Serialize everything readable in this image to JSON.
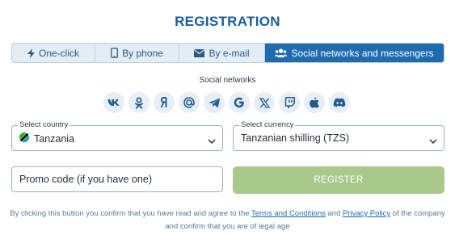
{
  "title": "REGISTRATION",
  "tabs": [
    {
      "label": "One-click",
      "icon": "lightning-icon",
      "active": false
    },
    {
      "label": "By phone",
      "icon": "phone-icon",
      "active": false
    },
    {
      "label": "By e-mail",
      "icon": "envelope-icon",
      "active": false
    },
    {
      "label": "Social networks and messengers",
      "icon": "users-icon",
      "active": true
    }
  ],
  "social": {
    "label": "Social networks",
    "networks": [
      {
        "name": "VK",
        "icon": "vk-icon",
        "glyph": "vk"
      },
      {
        "name": "Odnoklassniki",
        "icon": "odnoklassniki-icon",
        "glyph": "ok"
      },
      {
        "name": "Yandex",
        "icon": "yandex-icon",
        "glyph": "я"
      },
      {
        "name": "Mail.ru",
        "icon": "mail-ru-icon",
        "glyph": "@"
      },
      {
        "name": "Telegram",
        "icon": "telegram-icon",
        "glyph": "tg"
      },
      {
        "name": "Google",
        "icon": "google-icon",
        "glyph": "G"
      },
      {
        "name": "X",
        "icon": "x-icon",
        "glyph": "𝕏"
      },
      {
        "name": "Twitch",
        "icon": "twitch-icon",
        "glyph": "tw"
      },
      {
        "name": "Apple",
        "icon": "apple-icon",
        "glyph": "ap"
      },
      {
        "name": "Discord",
        "icon": "discord-icon",
        "glyph": "dc"
      }
    ]
  },
  "country": {
    "label": "Select country",
    "value": "Tanzania",
    "flag_icon": "tanzania-flag-icon"
  },
  "currency": {
    "label": "Select currency",
    "value": "Tanzanian shilling (TZS)"
  },
  "promo": {
    "placeholder": "Promo code (if you have one)",
    "value": ""
  },
  "register": {
    "label": "REGISTER"
  },
  "disclaimer": {
    "part1": "By clicking this button you confirm that you have read and agree to the ",
    "terms_link": "Terms and Conditions",
    "part2": " and ",
    "privacy_link": "Privacy Policy",
    "part3": " of the company and confirm that you are of legal age"
  },
  "colors": {
    "brand": "#1a5e9c",
    "active_tab": "#1f6bb0",
    "register_button": "#a9c98a",
    "field_border": "#93b3d2"
  }
}
